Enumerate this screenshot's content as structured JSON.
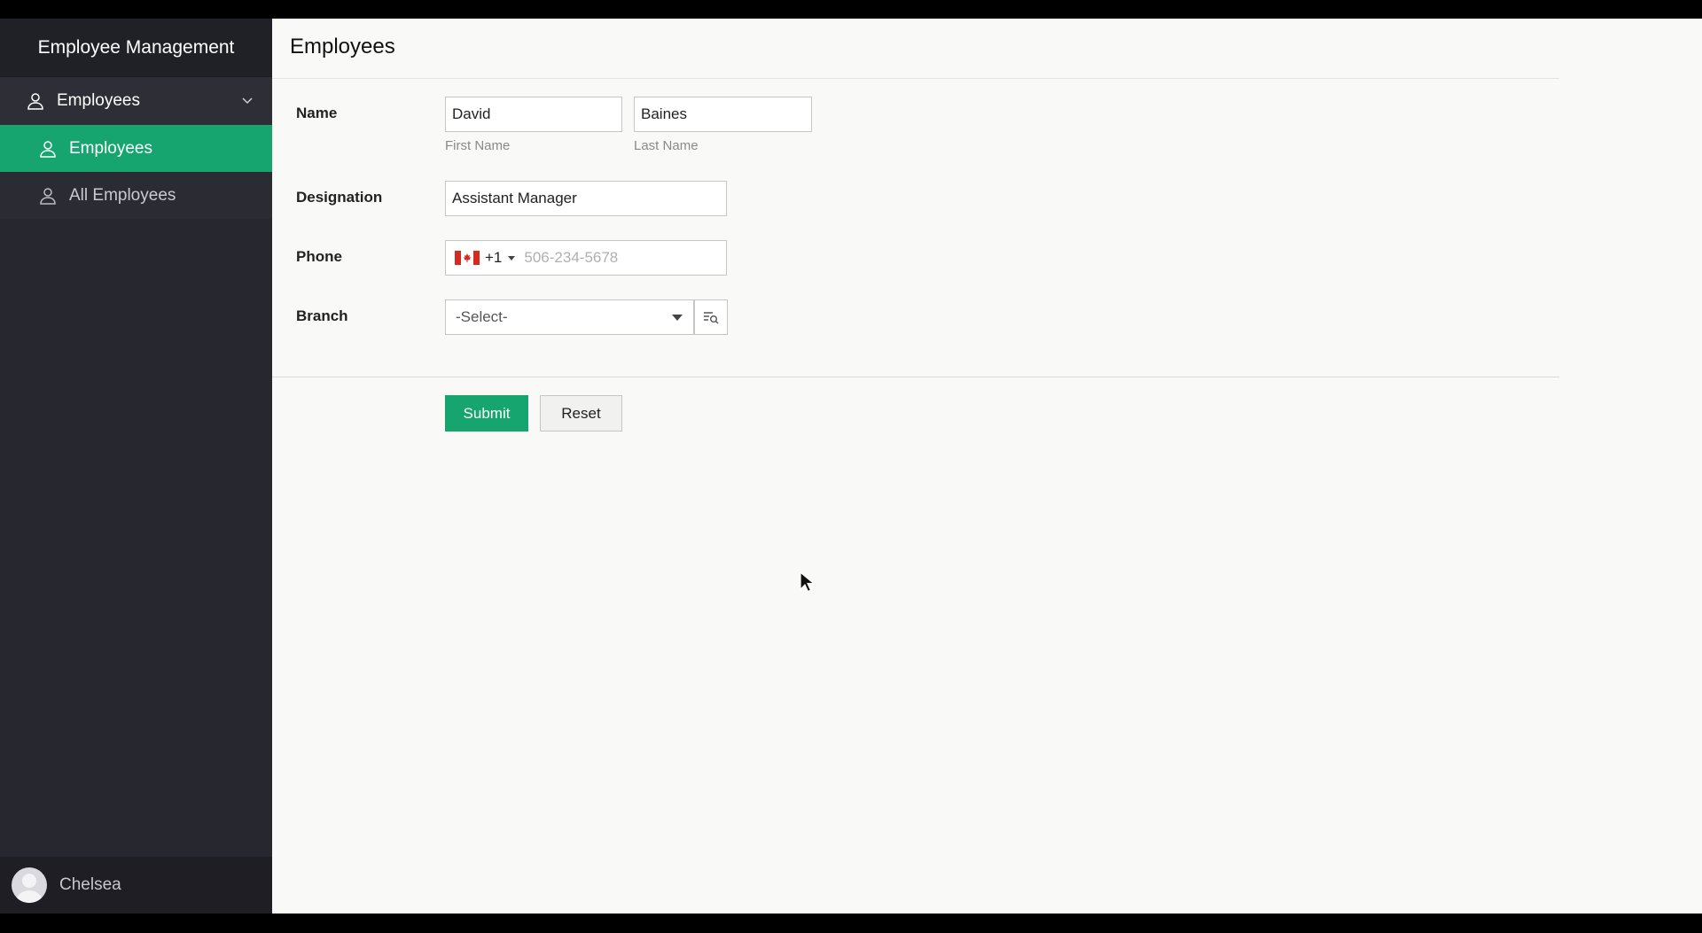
{
  "sidebar": {
    "app_title": "Employee Management",
    "group": {
      "label": "Employees",
      "icon": "user-icon"
    },
    "items": [
      {
        "label": "Employees",
        "icon": "user-icon",
        "active": true
      },
      {
        "label": "All Employees",
        "icon": "user-icon",
        "active": false
      }
    ],
    "user": {
      "name": "Chelsea"
    }
  },
  "main": {
    "title": "Employees",
    "form": {
      "name": {
        "label": "Name",
        "first_value": "David",
        "first_sublabel": "First Name",
        "last_value": "Baines",
        "last_sublabel": "Last Name"
      },
      "designation": {
        "label": "Designation",
        "value": "Assistant Manager"
      },
      "phone": {
        "label": "Phone",
        "country_code": "+1",
        "country_flag": "canada-flag-icon",
        "placeholder": "506-234-5678"
      },
      "branch": {
        "label": "Branch",
        "selected": "-Select-"
      }
    },
    "buttons": {
      "submit": "Submit",
      "reset": "Reset"
    }
  },
  "colors": {
    "accent": "#16a56f",
    "sidebar_bg": "#27272f",
    "main_bg": "#f9f9f7"
  }
}
